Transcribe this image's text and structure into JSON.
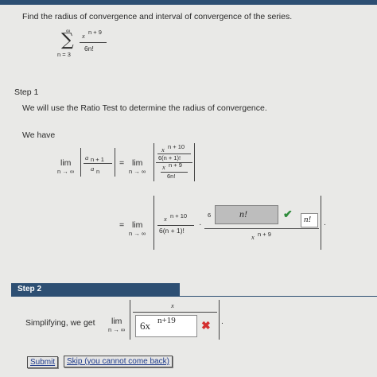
{
  "problem": {
    "instruction": "Find the radius of convergence and interval of convergence of the series.",
    "sum_upper": "∞",
    "sum_lower": "n = 3",
    "numerator": "x",
    "numerator_exp": "n + 9",
    "denominator": "6n!"
  },
  "step1": {
    "title": "Step 1",
    "text": "We will use the Ratio Test to determine the radius of convergence.",
    "we_have": "We have",
    "lim": "lim",
    "lim_sub": "n → ∞",
    "a": "a",
    "a_sub_next": "n + 1",
    "a_sub": "n",
    "eq": "=",
    "frac_num_top": "x",
    "frac_num_top_exp": "n + 10",
    "frac_num_bottom": "6(n + 1)!",
    "frac_den_top": "x",
    "frac_den_top_exp": "n + 9",
    "frac_den_bottom": "6n!",
    "line2_num": "x",
    "line2_num_exp": "n + 10",
    "line2_den": "6(n + 1)!",
    "dot": "·",
    "coef": "6",
    "answer1": "n!",
    "answer2": "n!",
    "line2_bottom": "x",
    "line2_bottom_exp": "n + 9",
    "period": "."
  },
  "step2": {
    "title": "Step 2",
    "text": "Simplifying, we get",
    "lim": "lim",
    "lim_sub": "n → ∞",
    "top": "x",
    "answer_text": "6x",
    "answer_exp": "n+19",
    "period": "."
  },
  "buttons": {
    "submit": "Submit",
    "skip": "Skip (you cannot come back)"
  },
  "icons": {
    "correct": "check-icon",
    "incorrect": "x-icon"
  }
}
